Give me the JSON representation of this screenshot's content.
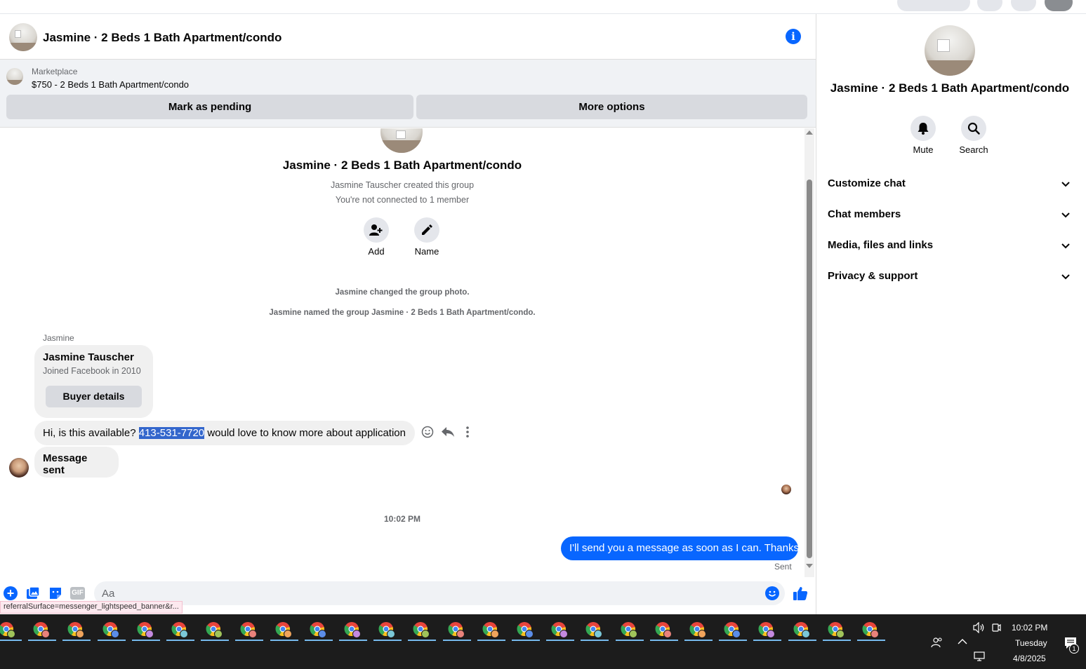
{
  "chat": {
    "title": "Jasmine · 2 Beds 1 Bath Apartment/condo"
  },
  "marketplace": {
    "label": "Marketplace",
    "listing": "$750 - 2 Beds 1 Bath Apartment/condo",
    "mark_pending": "Mark as pending",
    "more_options": "More options"
  },
  "thread": {
    "group_title": "Jasmine · 2 Beds 1 Bath Apartment/condo",
    "created_note": "Jasmine Tauscher created this group",
    "connection_note": "You're not connected to 1 member",
    "add_label": "Add",
    "name_label": "Name",
    "event_photo": "Jasmine changed the group photo.",
    "event_named": "Jasmine named the group Jasmine · 2 Beds 1 Bath Apartment/condo.",
    "sender_name": "Jasmine",
    "buyer_card": {
      "name": "Jasmine Tauscher",
      "joined": "Joined Facebook in 2010",
      "button": "Buyer details"
    },
    "message1_prefix": "Hi, is this available? ",
    "message1_highlight": "413-531-7720",
    "message1_suffix": " would love to know more about application",
    "message2": "Message sent",
    "timestamp": "10:02 PM",
    "my_message": "I'll send you a message as soon as I can. Thanks",
    "sent_status": "Sent"
  },
  "composer": {
    "placeholder": "Aa",
    "status_url": "referralSurface=messenger_lightspeed_banner&r..."
  },
  "right_panel": {
    "title": "Jasmine · 2 Beds 1 Bath Apartment/condo",
    "mute": "Mute",
    "search": "Search",
    "sections": [
      "Customize chat",
      "Chat members",
      "Media, files and links",
      "Privacy & support"
    ]
  },
  "taskbar": {
    "time": "10:02 PM",
    "day": "Tuesday",
    "date": "4/8/2025",
    "notification_count": "1"
  },
  "colors": {
    "accent": "#0866ff",
    "highlight": "#3366cc"
  }
}
